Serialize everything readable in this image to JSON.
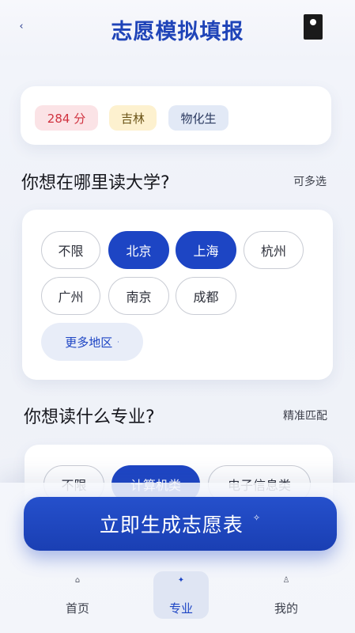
{
  "header": {
    "back_icon": "‹",
    "title": "志愿模拟填报",
    "menu_icon": "phone-menu-icon"
  },
  "profile_tags": {
    "score": "284 分",
    "province": "吉林",
    "subjects": "物化生"
  },
  "city_section": {
    "question": "你想在哪里读大学?",
    "hint": "可多选",
    "chips": [
      {
        "label": "不限",
        "selected": false
      },
      {
        "label": "北京",
        "selected": true
      },
      {
        "label": "上海",
        "selected": true
      },
      {
        "label": "杭州",
        "selected": false
      },
      {
        "label": "广州",
        "selected": false
      },
      {
        "label": "南京",
        "selected": false
      },
      {
        "label": "成都",
        "selected": false
      }
    ],
    "more_label": "更多地区",
    "more_icon": "·"
  },
  "major_section": {
    "question": "你想读什么专业?",
    "hint": "精准匹配",
    "chips": [
      {
        "label": "不限",
        "selected": false
      },
      {
        "label": "计算机类",
        "selected": true
      },
      {
        "label": "电子信息类",
        "selected": false
      }
    ]
  },
  "cta": {
    "label": "立即生成志愿表",
    "icon": "✧"
  },
  "bottom_nav": [
    {
      "label": "首页",
      "icon": "⌂",
      "active": false
    },
    {
      "label": "专业",
      "icon": "✦",
      "active": true
    },
    {
      "label": "我的",
      "icon": "♙",
      "active": false
    }
  ],
  "colors": {
    "accent": "#1d45c4",
    "title": "#1f44b8",
    "score_bg": "#fbe3e6",
    "score_text": "#d0323f",
    "province_bg": "#fdf1cf",
    "subjects_bg": "#e2e9f6"
  }
}
